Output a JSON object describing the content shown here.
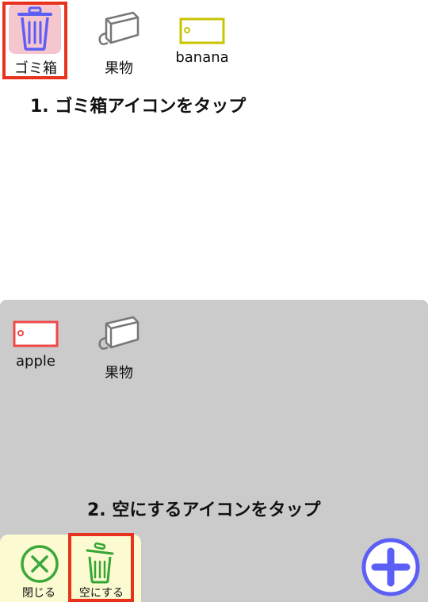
{
  "top_row": {
    "trash_label": "ゴミ箱",
    "fruit_label": "果物",
    "banana_label": "banana"
  },
  "instructions": {
    "step1": "1. ゴミ箱アイコンをタップ",
    "step2": "2. 空にするアイコンをタップ"
  },
  "panel": {
    "apple_label": "apple",
    "fruit_label": "果物"
  },
  "toolbar": {
    "close_label": "閉じる",
    "empty_label": "空にする"
  },
  "icons": {
    "trash": "trash-icon",
    "fruit": "box-tag-icon",
    "banana": "tag-icon",
    "apple": "tag-icon",
    "close": "circle-x-icon",
    "empty": "trash-icon",
    "add": "circle-plus-icon"
  },
  "colors": {
    "highlight": "#e8321e",
    "trash_blue": "#5b5ff6",
    "banana_tag": "#c8c400",
    "apple_tag": "#f04848",
    "close_green": "#3aa83a",
    "empty_green": "#33a633",
    "add_blue": "#5b5ff6"
  }
}
